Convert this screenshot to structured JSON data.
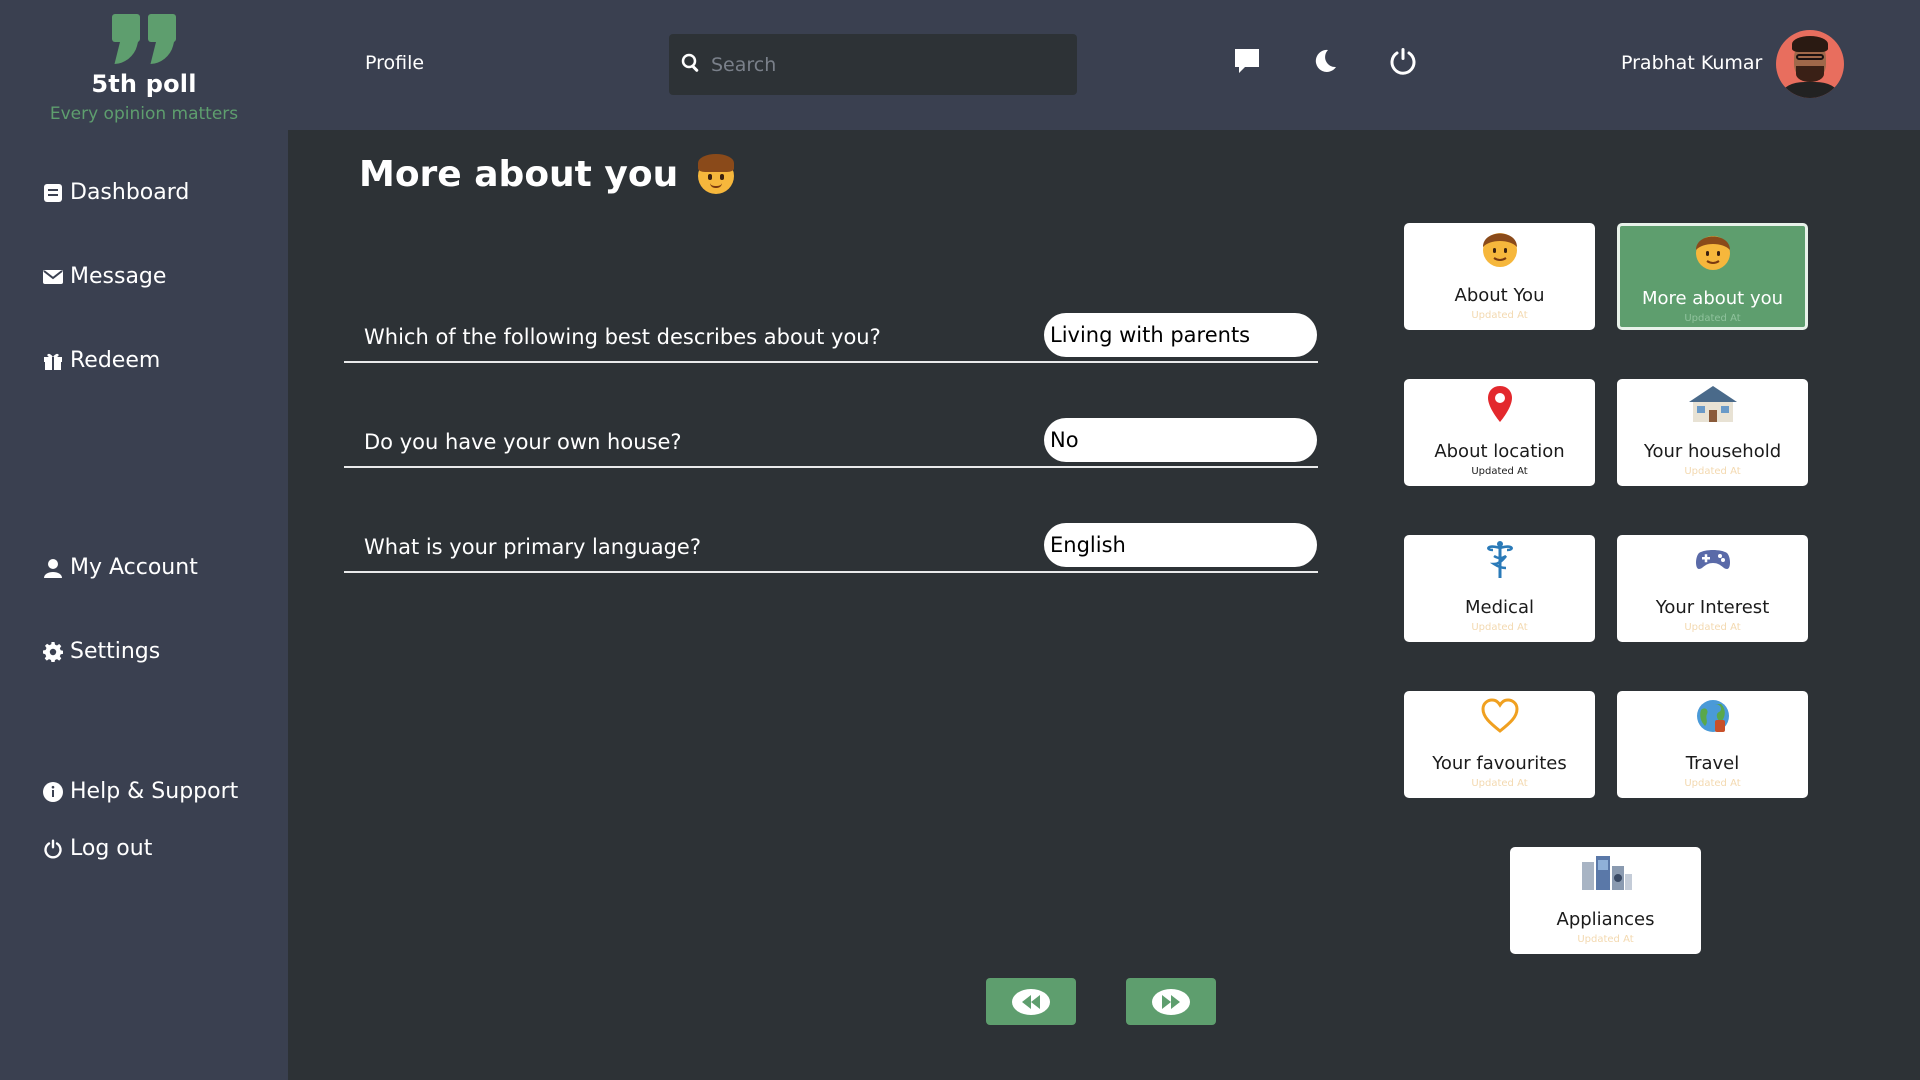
{
  "brand": {
    "name": "5th poll",
    "tagline": "Every opinion matters",
    "accent_color": "#5e9e6e"
  },
  "topbar": {
    "profile_label": "Profile",
    "search_placeholder": "Search",
    "icons": [
      "chat-icon",
      "moon-icon",
      "power-icon"
    ],
    "user_name": "Prabhat Kumar"
  },
  "sidebar": {
    "items": [
      {
        "label": "Dashboard",
        "icon": "dashboard-icon"
      },
      {
        "label": "Message",
        "icon": "envelope-icon"
      },
      {
        "label": "Redeem",
        "icon": "gift-icon"
      },
      {
        "label": "My Account",
        "icon": "user-icon"
      },
      {
        "label": "Settings",
        "icon": "gear-icon"
      },
      {
        "label": "Help & Support",
        "icon": "info-icon"
      },
      {
        "label": "Log out",
        "icon": "power-icon"
      }
    ]
  },
  "main": {
    "title": "More about you",
    "questions": [
      {
        "text": "Which of the following best describes about you?",
        "answer": "Living with parents"
      },
      {
        "text": "Do you have your own house?",
        "answer": "No"
      },
      {
        "text": "What is your primary language?",
        "answer": "English"
      }
    ]
  },
  "cards": [
    {
      "label": "About You",
      "sub": "Updated At",
      "icon": "boy-emoji-icon",
      "active": false
    },
    {
      "label": "More about you",
      "sub": "Updated At",
      "icon": "boy-emoji-icon",
      "active": true
    },
    {
      "label": "About location",
      "sub": "Updated At",
      "icon": "location-pin-icon",
      "active": false
    },
    {
      "label": "Your household",
      "sub": "Updated At",
      "icon": "house-icon",
      "active": false
    },
    {
      "label": "Medical",
      "sub": "Updated At",
      "icon": "caduceus-icon",
      "active": false
    },
    {
      "label": "Your Interest",
      "sub": "Updated At",
      "icon": "gamepad-icon",
      "active": false
    },
    {
      "label": "Your favourites",
      "sub": "Updated At",
      "icon": "heart-icon",
      "active": false
    },
    {
      "label": "Travel",
      "sub": "Updated At",
      "icon": "globe-icon",
      "active": false
    },
    {
      "label": "Appliances",
      "sub": "Updated At",
      "icon": "appliances-icon",
      "active": false
    }
  ],
  "pager": {
    "prev_icon": "rewind-icon",
    "next_icon": "fast-forward-icon"
  }
}
